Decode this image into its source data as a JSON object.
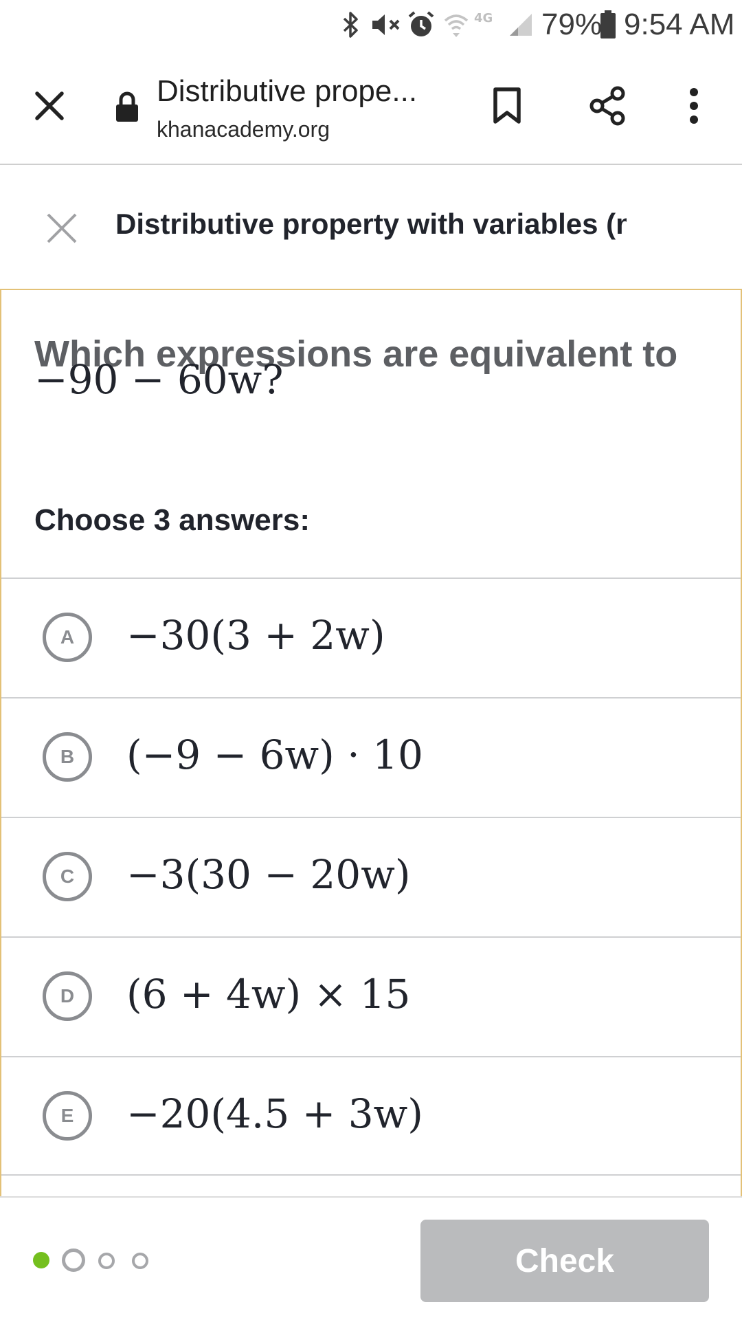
{
  "status_bar": {
    "network": "4G",
    "battery": "79%",
    "time": "9:54 AM"
  },
  "browser": {
    "page_title": "Distributive prope...",
    "url": "khanacademy.org",
    "icons": [
      "close-icon",
      "lock-icon",
      "bookmark-icon",
      "share-icon",
      "more-vert-icon"
    ]
  },
  "exercise": {
    "title": "Distributive property with variables (n"
  },
  "question": {
    "prompt": "Which expressions are equivalent to",
    "expression": "−90 − 60w?",
    "instruction": "Choose 3 answers:",
    "choices": [
      {
        "letter": "A",
        "expression": "−30(3 + 2w)"
      },
      {
        "letter": "B",
        "expression": "(−9 − 6w) · 10"
      },
      {
        "letter": "C",
        "expression": "−3(30 − 20w)"
      },
      {
        "letter": "D",
        "expression": "(6 + 4w) × 15"
      },
      {
        "letter": "E",
        "expression": "−20(4.5 + 3w)"
      }
    ]
  },
  "footer": {
    "check_label": "Check",
    "progress": {
      "total": 4,
      "current": 2,
      "completed": 1
    },
    "colors": {
      "completed": "#74bf1e",
      "button_disabled": "#babbbd"
    }
  }
}
